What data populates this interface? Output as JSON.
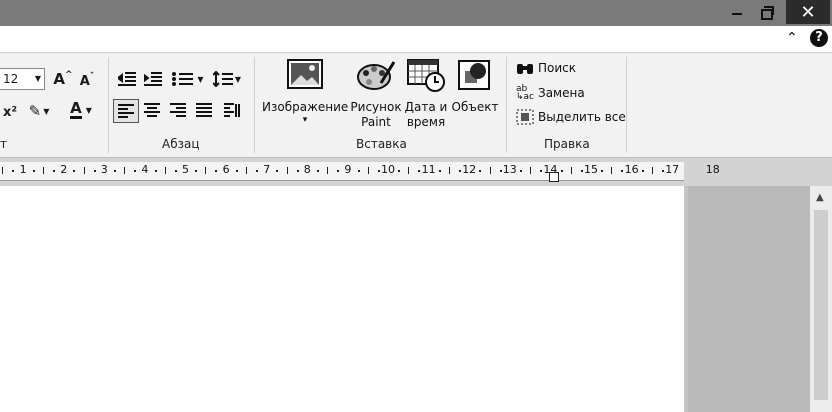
{
  "window": {
    "minimize_icon": "minimize-icon",
    "maximize_icon": "restore-icon",
    "close_label": "✕"
  },
  "helpbar": {
    "collapse_label": "⌃",
    "help_label": "?"
  },
  "ribbon": {
    "font": {
      "size_value": "12",
      "group_label_partial": "т",
      "superscript_label": "x²",
      "grow_label": "A",
      "shrink_label": "A",
      "font_color_label": "A"
    },
    "paragraph": {
      "group_label": "Абзац"
    },
    "insert": {
      "group_label": "Вставка",
      "image_label": "Изображение",
      "image_dropdown": "▾",
      "paint_label_line1": "Рисунок",
      "paint_label_line2": "Paint",
      "datetime_label_line1": "Дата и",
      "datetime_label_line2": "время",
      "object_label": "Объект"
    },
    "edit": {
      "group_label": "Правка",
      "find_label": "Поиск",
      "replace_label": "Замена",
      "select_all_label": "Выделить все"
    }
  },
  "ruler": {
    "numbers": [
      "1",
      "2",
      "3",
      "4",
      "5",
      "6",
      "7",
      "8",
      "9",
      "10",
      "11",
      "12",
      "13",
      "14",
      "15",
      "16",
      "17",
      "18"
    ]
  },
  "colors": {
    "titlebar": "#7a7a7a",
    "ribbon": "#f2f2f2",
    "close": "#2b2b2b",
    "side_pane": "#b9b9b9"
  }
}
